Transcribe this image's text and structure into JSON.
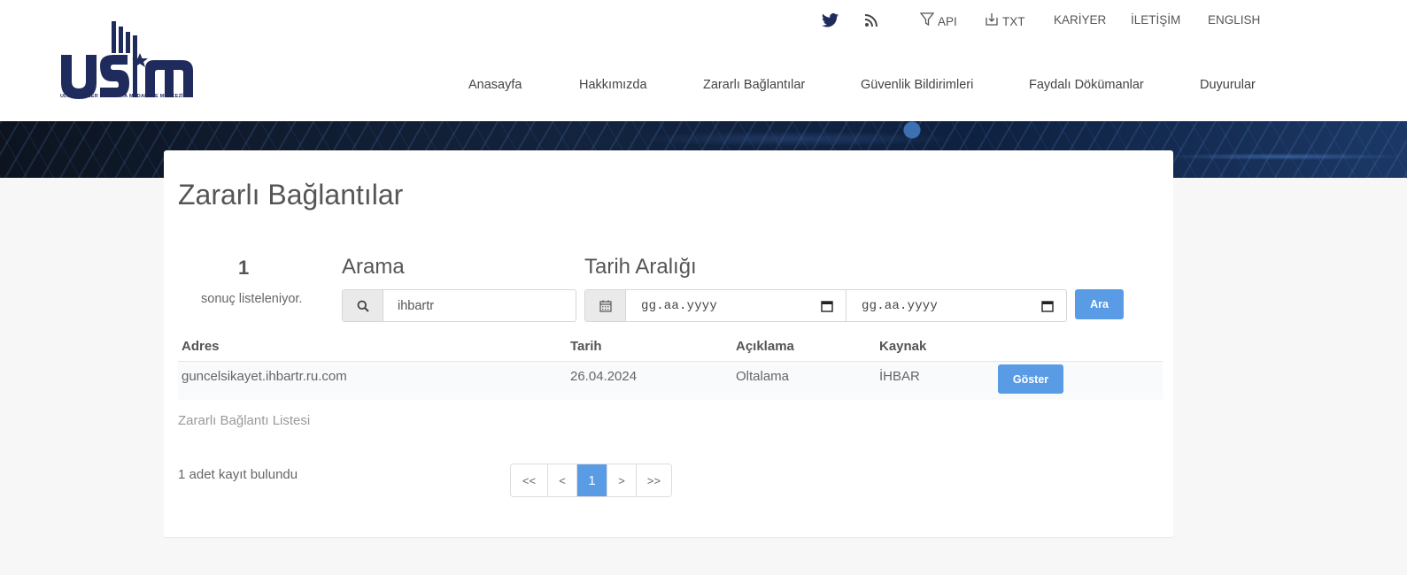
{
  "logo": {
    "subtitle": "ULUSAL SİBER OLAYLARA MÜDAHALE MERKEZİ",
    "brand_color": "#1f2b5c"
  },
  "topbar": {
    "icons": [
      "twitter-icon",
      "rss-icon"
    ],
    "api_label": "API",
    "txt_label": "TXT",
    "kariyer_label": "KARİYER",
    "iletisim_label": "İLETİŞİM",
    "english_label": "ENGLISH"
  },
  "nav": {
    "items": [
      "Anasayfa",
      "Hakkımızda",
      "Zararlı Bağlantılar",
      "Güvenlik Bildirimleri",
      "Faydalı Dökümanlar",
      "Duyurular"
    ]
  },
  "page": {
    "title": "Zararlı Bağlantılar"
  },
  "results": {
    "count": "1",
    "label": "sonuç listeleniyor."
  },
  "search": {
    "label": "Arama",
    "value": "ihbartr",
    "icon": "search-icon"
  },
  "date_range": {
    "label": "Tarih Aralığı",
    "from_placeholder": "gg.aa.yyyy",
    "to_placeholder": "gg.aa.yyyy",
    "icon": "calendar-icon"
  },
  "search_button": "Ara",
  "table": {
    "headers": [
      "Adres",
      "Tarih",
      "Açıklama",
      "Kaynak"
    ],
    "rows": [
      {
        "adres": "guncelsikayet.ihbartr.ru.com",
        "tarih": "26.04.2024",
        "aciklama": "Oltalama",
        "kaynak": "İHBAR",
        "action": "Göster"
      }
    ],
    "caption": "Zararlı Bağlantı Listesi"
  },
  "footer": {
    "records_text": "1 adet kayıt bulundu"
  },
  "pagination": {
    "first": "<<",
    "prev": "<",
    "current": "1",
    "next": ">",
    "last": ">>"
  },
  "colors": {
    "accent": "#5a9be6",
    "text": "#555555",
    "background": "#f7f7f7"
  }
}
